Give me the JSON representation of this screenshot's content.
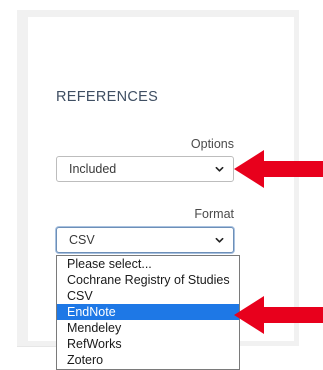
{
  "section": {
    "title": "REFERENCES"
  },
  "options_field": {
    "label": "Options",
    "value": "Included"
  },
  "format_field": {
    "label": "Format",
    "value": "CSV",
    "dropdown_open": true,
    "items": [
      {
        "label": "Please select...",
        "selected": false
      },
      {
        "label": "Cochrane Registry of Studies",
        "selected": false
      },
      {
        "label": "CSV",
        "selected": false
      },
      {
        "label": "EndNote",
        "selected": true
      },
      {
        "label": "Mendeley",
        "selected": false
      },
      {
        "label": "RefWorks",
        "selected": false
      },
      {
        "label": "Zotero",
        "selected": false
      }
    ]
  },
  "annotations": {
    "arrow_color": "#e8001c",
    "selected_highlight_color": "#1e78e6",
    "icons": [
      "chevron-down-icon",
      "red-arrow-icon"
    ]
  }
}
